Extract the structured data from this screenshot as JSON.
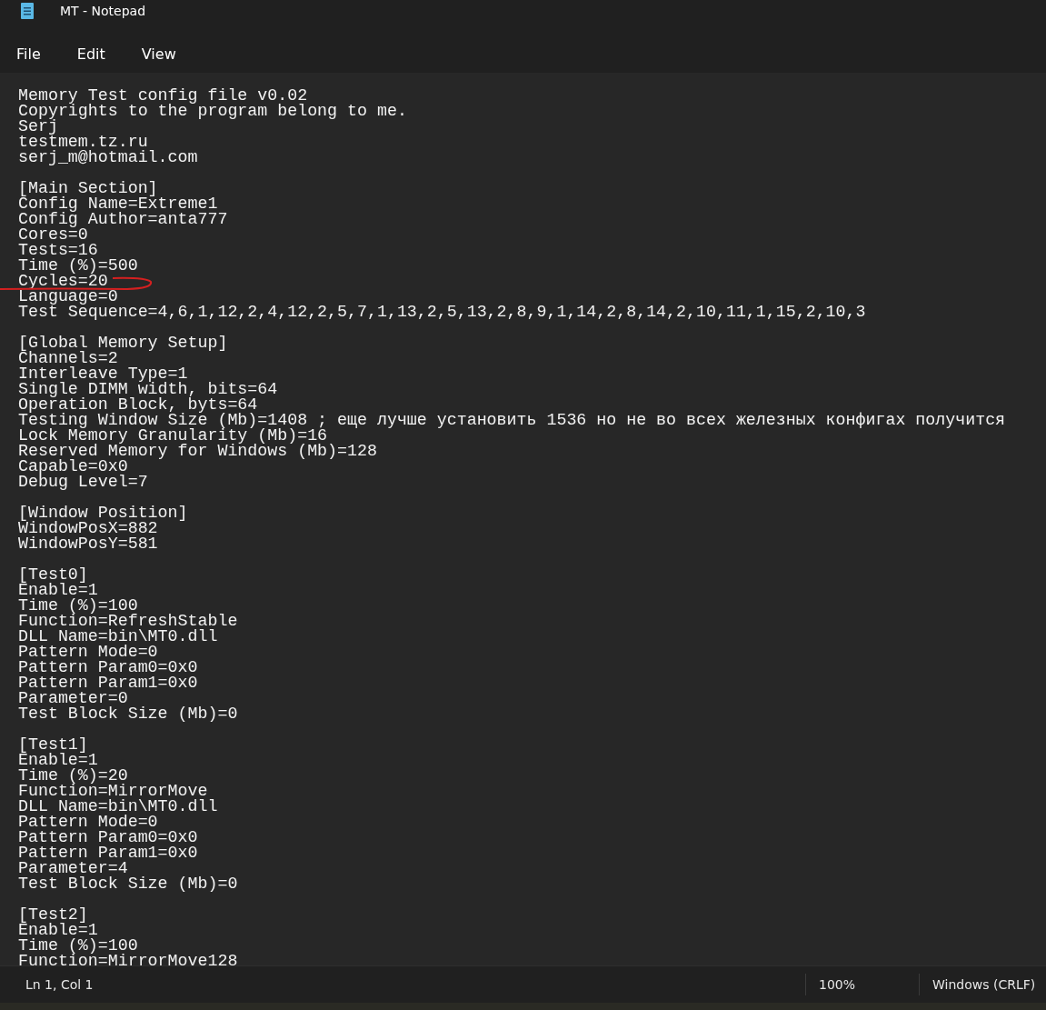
{
  "window": {
    "title": "MT - Notepad"
  },
  "menu": [
    "File",
    "Edit",
    "View"
  ],
  "editor": {
    "blocks": [
      [
        "Memory Test config file v0.02",
        "Copyrights to the program belong to me.",
        "Serj",
        "testmem.tz.ru",
        "serj_m@hotmail.com"
      ],
      [
        "[Main Section]",
        "Config Name=Extreme1",
        "Config Author=anta777",
        "Cores=0",
        "Tests=16",
        "Time (%)=500",
        "Cycles=20",
        "Language=0",
        "Test Sequence=4,6,1,12,2,4,12,2,5,7,1,13,2,5,13,2,8,9,1,14,2,8,14,2,10,11,1,15,2,10,3"
      ],
      [
        "[Global Memory Setup]",
        "Channels=2",
        "Interleave Type=1",
        "Single DIMM width, bits=64",
        "Operation Block, byts=64",
        "Testing Window Size (Mb)=1408 ; еще лучше установить 1536 но не во всех железных конфигах получится",
        "Lock Memory Granularity (Mb)=16",
        "Reserved Memory for Windows (Mb)=128",
        "Capable=0x0",
        "Debug Level=7"
      ],
      [
        "[Window Position]",
        "WindowPosX=882",
        "WindowPosY=581"
      ],
      [
        "[Test0]",
        "Enable=1",
        "Time (%)=100",
        "Function=RefreshStable",
        "DLL Name=bin\\MT0.dll",
        "Pattern Mode=0",
        "Pattern Param0=0x0",
        "Pattern Param1=0x0",
        "Parameter=0",
        "Test Block Size (Mb)=0"
      ],
      [
        "[Test1]",
        "Enable=1",
        "Time (%)=20",
        "Function=MirrorMove",
        "DLL Name=bin\\MT0.dll",
        "Pattern Mode=0",
        "Pattern Param0=0x0",
        "Pattern Param1=0x0",
        "Parameter=4",
        "Test Block Size (Mb)=0"
      ],
      [
        "[Test2]",
        "Enable=1",
        "Time (%)=100",
        "Function=MirrorMove128"
      ]
    ]
  },
  "status_bar": {
    "position": "Ln 1, Col 1",
    "zoom": "100%",
    "line_ending": "Windows (CRLF)"
  }
}
